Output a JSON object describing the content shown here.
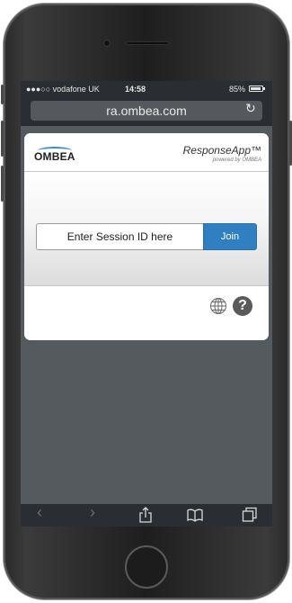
{
  "status_bar": {
    "carrier": "●●●○○ vodafone UK",
    "time": "14:58",
    "battery": "85%"
  },
  "browser": {
    "url": "ra.ombea.com",
    "reload_icon": "reload-icon"
  },
  "app": {
    "logo_text": "OMBEA",
    "title": "ResponseApp™",
    "subtitle": "powered by OMBEA",
    "session_placeholder": "Enter Session ID here",
    "join_label": "Join",
    "footer_icons": [
      "globe-icon",
      "help-icon"
    ],
    "help_glyph": "?"
  },
  "toolbar": {
    "back": "‹",
    "forward": "›",
    "icons": [
      "back-arrow-icon",
      "forward-arrow-icon",
      "share-icon",
      "bookmarks-icon",
      "tabs-icon"
    ]
  },
  "colors": {
    "accent": "#2f7fc1",
    "logo_arc": "#3b8fd6"
  }
}
